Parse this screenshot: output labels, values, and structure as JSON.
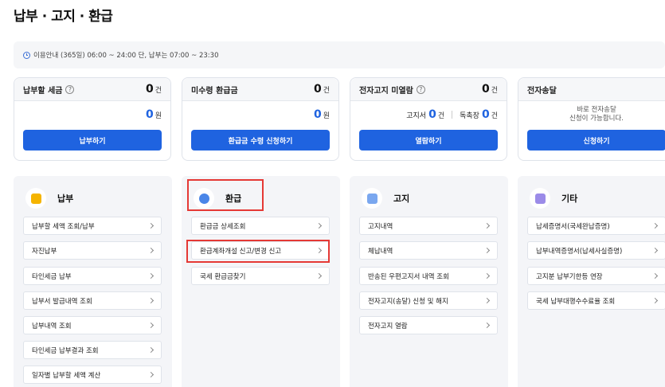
{
  "page": {
    "title": "납부 · 고지 · 환급"
  },
  "notice": {
    "text": "이용안내 (365일) 06:00 ~ 24:00 단, 납부는 07:00 ~ 23:30"
  },
  "cards": [
    {
      "title": "납부할 세금",
      "count": "0",
      "count_unit": "건",
      "amount": "0",
      "amount_unit": "원",
      "button": "납부하기"
    },
    {
      "title": "미수령 환급금",
      "count": "0",
      "count_unit": "건",
      "amount": "0",
      "amount_unit": "원",
      "button": "환급금 수령 신청하기"
    },
    {
      "title": "전자고지 미열람",
      "count": "0",
      "count_unit": "건",
      "notice_label": "고지서",
      "notice_count": "0",
      "notice_unit": "건",
      "demand_label": "독촉장",
      "demand_count": "0",
      "demand_unit": "건",
      "button": "열람하기"
    },
    {
      "title": "전자송달",
      "msg_line1": "바로 전자송달",
      "msg_line2": "신청이 가능합니다.",
      "button": "신청하기"
    }
  ],
  "panels": [
    {
      "title": "납부",
      "items": [
        "납부할 세액 조회/납부",
        "자진납부",
        "타인세금 납부",
        "납부서 발급내역 조회",
        "납부내역 조회",
        "타인세금 납부결과 조회",
        "일자별 납부할 세액 계산"
      ]
    },
    {
      "title": "환급",
      "items": [
        "환급금 상세조회",
        "환급계좌개설 신고/변경 신고",
        "국세 환급금찾기"
      ]
    },
    {
      "title": "고지",
      "items": [
        "고지내역",
        "체납내역",
        "반송된 우편고지서 내역 조회",
        "전자고지(송달) 신청 및 해지",
        "전자고지 열람"
      ]
    },
    {
      "title": "기타",
      "items": [
        "납세증명서(국세완납증명)",
        "납부내역증명서(납세사실증명)",
        "고지분 납부기한등 연장",
        "국세 납부대행수수료율 조회"
      ]
    }
  ],
  "colors": {
    "primary": "#1f63e0",
    "highlight": "#e53935"
  }
}
